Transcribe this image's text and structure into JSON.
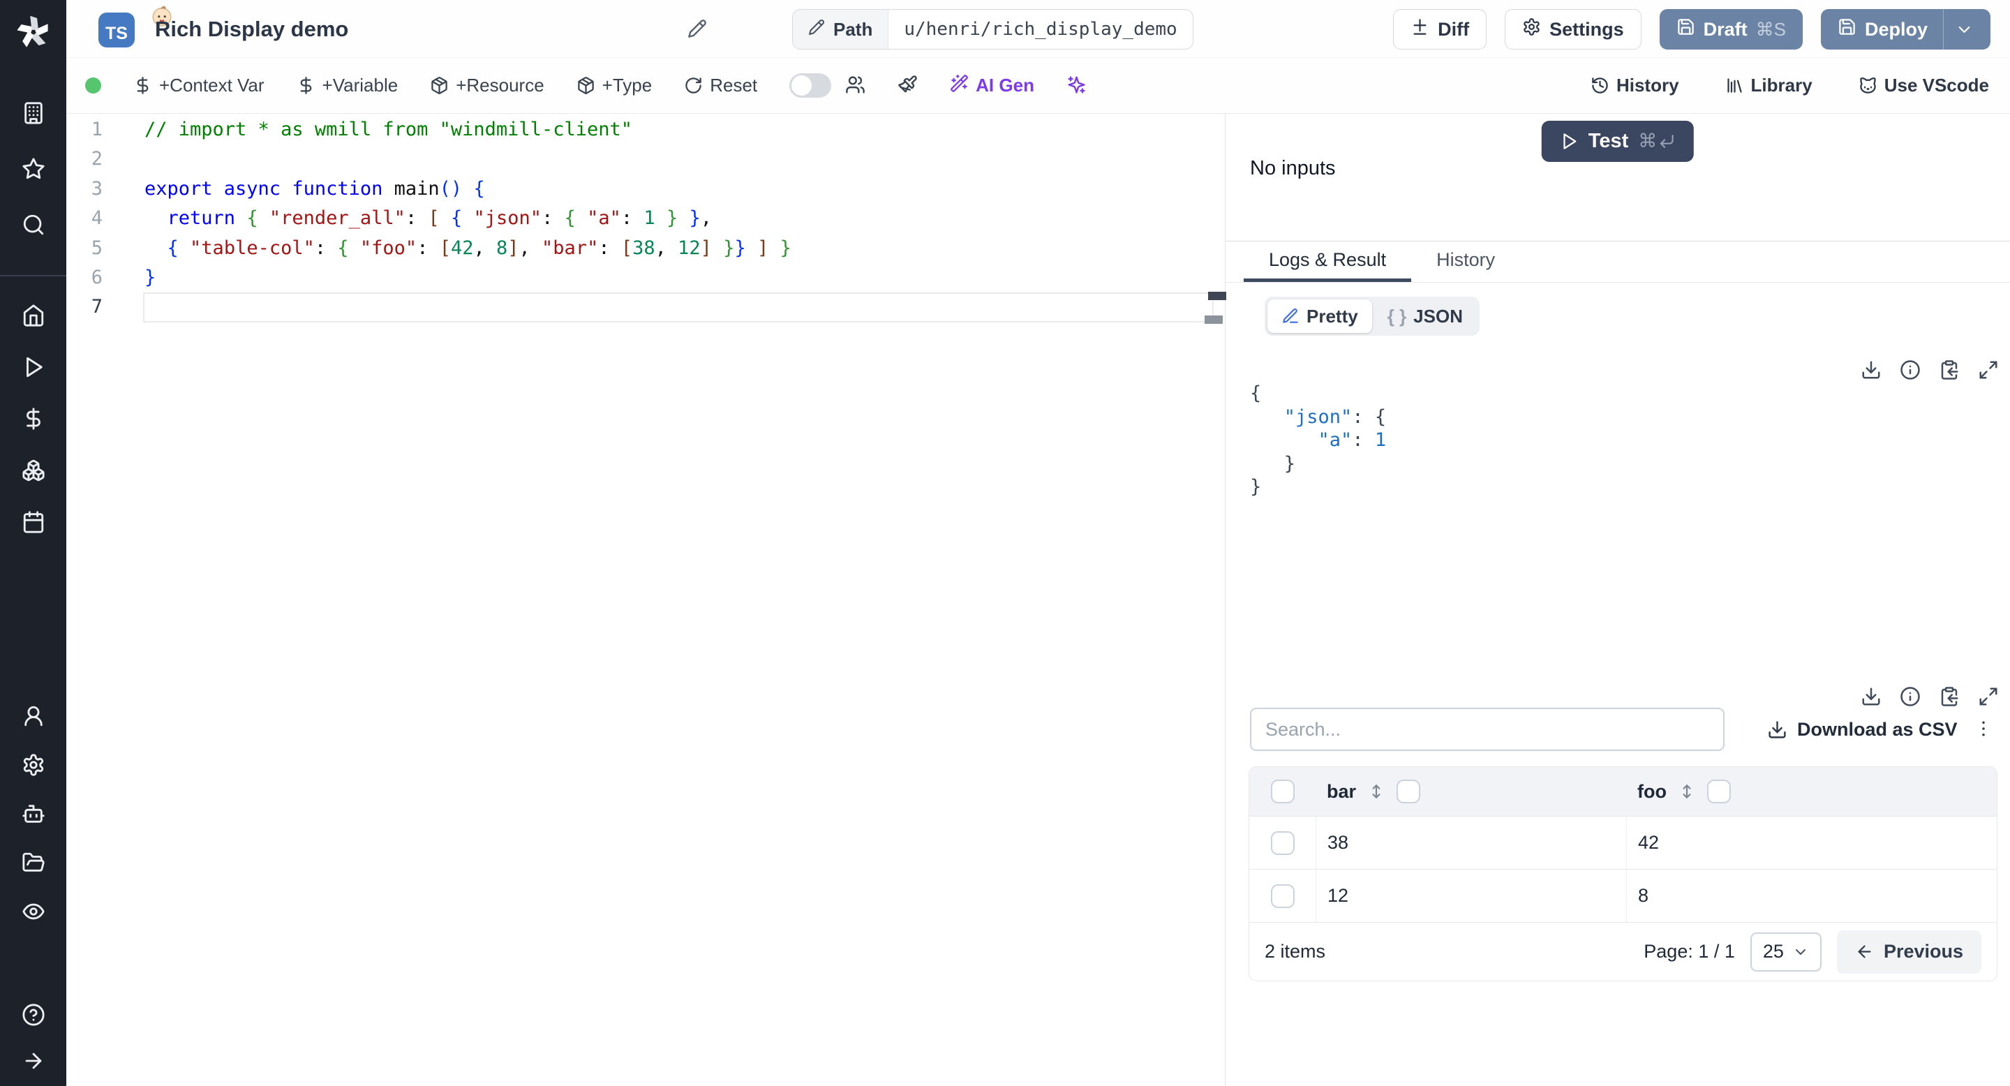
{
  "topbar": {
    "language_badge": "TS",
    "title": "Rich Display demo",
    "path": {
      "label": "Path",
      "value": "u/henri/rich_display_demo"
    },
    "buttons": {
      "diff": "Diff",
      "settings": "Settings",
      "draft": "Draft",
      "draft_shortcut": "⌘S",
      "deploy": "Deploy"
    }
  },
  "toolbar": {
    "left_items": [
      {
        "icon": "dollar",
        "label": "+Context Var"
      },
      {
        "icon": "dollar",
        "label": "+Variable"
      },
      {
        "icon": "package",
        "label": "+Resource"
      },
      {
        "icon": "package",
        "label": "+Type"
      },
      {
        "icon": "rotate-cw",
        "label": "Reset"
      }
    ],
    "ai_gen_label": "AI Gen",
    "right_items": [
      {
        "icon": "history",
        "label": "History"
      },
      {
        "icon": "library",
        "label": "Library"
      },
      {
        "icon": "cat",
        "label": "Use VScode"
      }
    ]
  },
  "sidebar": {
    "top_icons": [
      "building",
      "star",
      "search"
    ],
    "main_icons": [
      "home",
      "play",
      "dollar",
      "boxes",
      "calendar"
    ],
    "lower_icons": [
      "user",
      "settings",
      "bot",
      "folder-open",
      "eye"
    ],
    "bottom_icons": [
      "help-circle",
      "arrow-right"
    ]
  },
  "editor": {
    "active_line": 7,
    "line_count": 7,
    "lines": [
      [
        [
          "// import * as wmill from \"windmill-client\"",
          "c"
        ]
      ],
      [],
      [
        [
          "export async function",
          "k"
        ],
        [
          " main",
          "p"
        ],
        [
          "(",
          "b1"
        ],
        [
          ")",
          "b1"
        ],
        [
          " ",
          "p"
        ],
        [
          "{",
          "b1"
        ]
      ],
      [
        [
          "  ",
          "p"
        ],
        [
          "return",
          "k"
        ],
        [
          " ",
          "p"
        ],
        [
          "{",
          "b2"
        ],
        [
          " ",
          "p"
        ],
        [
          "\"render_all\"",
          "s"
        ],
        [
          ": ",
          "p"
        ],
        [
          "[",
          "b3"
        ],
        [
          " ",
          "p"
        ],
        [
          "{",
          "b1"
        ],
        [
          " ",
          "p"
        ],
        [
          "\"json\"",
          "s"
        ],
        [
          ": ",
          "p"
        ],
        [
          "{",
          "b2"
        ],
        [
          " ",
          "p"
        ],
        [
          "\"a\"",
          "s"
        ],
        [
          ": ",
          "p"
        ],
        [
          "1",
          "n"
        ],
        [
          " ",
          "p"
        ],
        [
          "}",
          "b2"
        ],
        [
          " ",
          "p"
        ],
        [
          "}",
          "b1"
        ],
        [
          ",",
          "p"
        ]
      ],
      [
        [
          "  ",
          "p"
        ],
        [
          "{",
          "b1"
        ],
        [
          " ",
          "p"
        ],
        [
          "\"table-col\"",
          "s"
        ],
        [
          ": ",
          "p"
        ],
        [
          "{",
          "b2"
        ],
        [
          " ",
          "p"
        ],
        [
          "\"foo\"",
          "s"
        ],
        [
          ": ",
          "p"
        ],
        [
          "[",
          "b3"
        ],
        [
          "42",
          "n"
        ],
        [
          ", ",
          "p"
        ],
        [
          "8",
          "n"
        ],
        [
          "]",
          "b3"
        ],
        [
          ", ",
          "p"
        ],
        [
          "\"bar\"",
          "s"
        ],
        [
          ": ",
          "p"
        ],
        [
          "[",
          "b3"
        ],
        [
          "38",
          "n"
        ],
        [
          ", ",
          "p"
        ],
        [
          "12",
          "n"
        ],
        [
          "]",
          "b3"
        ],
        [
          " ",
          "p"
        ],
        [
          "}",
          "b2"
        ],
        [
          "}",
          "b1"
        ],
        [
          " ",
          "p"
        ],
        [
          "]",
          "b3"
        ],
        [
          " ",
          "p"
        ],
        [
          "}",
          "b2"
        ]
      ],
      [
        [
          "}",
          "b1"
        ]
      ],
      []
    ]
  },
  "preview": {
    "test_label": "Test",
    "test_shortcut_cmd": "⌘",
    "no_inputs": "No inputs",
    "tabs": [
      {
        "label": "Logs & Result",
        "active": true
      },
      {
        "label": "History",
        "active": false
      }
    ],
    "result_view": {
      "pretty": "Pretty",
      "json": "JSON",
      "braces_glyph": "{ }"
    },
    "result_icons": [
      "download",
      "info",
      "clipboard-copy",
      "maximize"
    ],
    "result_lines": [
      [
        [
          "{",
          "rp"
        ]
      ],
      [
        [
          "   ",
          "rp"
        ],
        [
          "\"json\"",
          "rk"
        ],
        [
          ":",
          "rp"
        ],
        [
          " ",
          "rp"
        ],
        [
          "{",
          "rp"
        ]
      ],
      [
        [
          "      ",
          "rp"
        ],
        [
          "\"a\"",
          "rk"
        ],
        [
          ":",
          "rp"
        ],
        [
          " ",
          "rp"
        ],
        [
          "1",
          "rk"
        ]
      ],
      [
        [
          "   ",
          "rp"
        ],
        [
          "}",
          "rp"
        ]
      ],
      [
        [
          "}",
          "rp"
        ]
      ]
    ],
    "search_placeholder": "Search...",
    "download_csv": "Download as CSV",
    "table": {
      "columns": [
        "bar",
        "foo"
      ],
      "rows": [
        [
          "38",
          "42"
        ],
        [
          "12",
          "8"
        ]
      ],
      "items_label": "2 items",
      "page_label": "Page: 1 / 1",
      "page_size": "25",
      "previous": "Previous"
    }
  },
  "colors": {
    "sidebar_bg": "#1d212a",
    "accent_slate": "#6b84a6",
    "test_navy": "#3b4660",
    "ai_purple": "#7c3aed",
    "status_green": "#55c56e",
    "json_key_blue": "#1d6fc4"
  }
}
